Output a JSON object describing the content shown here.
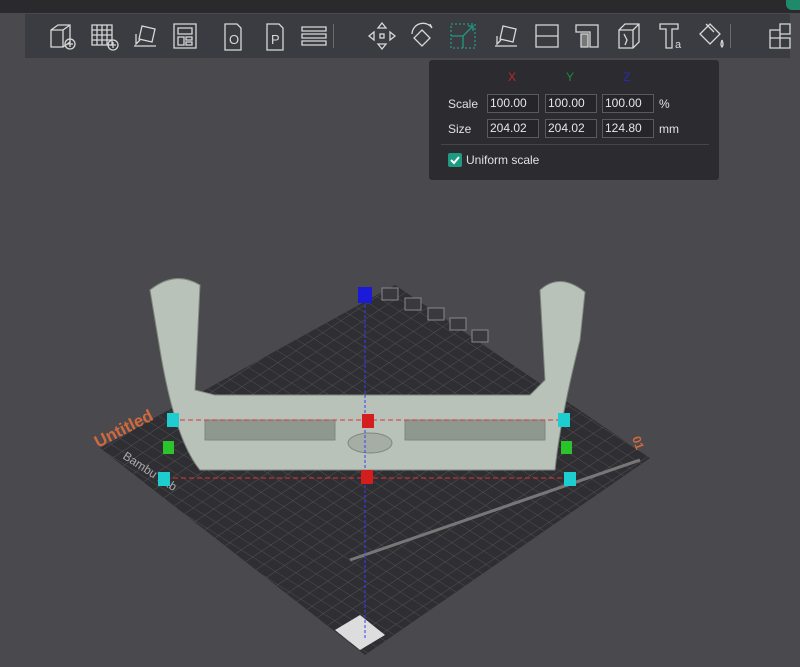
{
  "toolbar": {
    "tools": [
      {
        "name": "add-object-icon"
      },
      {
        "name": "add-plate-icon"
      },
      {
        "name": "auto-orient-icon"
      },
      {
        "name": "arrange-icon"
      },
      {
        "name": "object-tab-icon",
        "label": "O"
      },
      {
        "name": "plate-tab-icon",
        "label": "P"
      },
      {
        "name": "layers-icon"
      },
      {
        "name": "move-icon"
      },
      {
        "name": "rotate-icon"
      },
      {
        "name": "scale-icon",
        "active": true
      },
      {
        "name": "lay-on-face-icon"
      },
      {
        "name": "cut-icon"
      },
      {
        "name": "support-paint-icon"
      },
      {
        "name": "seam-paint-icon"
      },
      {
        "name": "text-icon",
        "label": "T"
      },
      {
        "name": "color-paint-icon"
      },
      {
        "name": "assembly-icon"
      }
    ]
  },
  "scale_panel": {
    "axes": {
      "x": "X",
      "y": "Y",
      "z": "Z"
    },
    "axis_colors": {
      "x": "#c0262b",
      "y": "#1c8a3a",
      "z": "#2a2ab8"
    },
    "scale_label": "Scale",
    "size_label": "Size",
    "scale": {
      "x": "100.00",
      "y": "100.00",
      "z": "100.00",
      "unit": "%"
    },
    "size": {
      "x": "204.02",
      "y": "204.02",
      "z": "124.80",
      "unit": "mm"
    },
    "uniform_scale_label": "Uniform scale",
    "uniform_scale_checked": true
  },
  "plate": {
    "name": "Untitled",
    "brand": "Bambu Lab",
    "number": "01"
  },
  "accent": "#1f9a82"
}
